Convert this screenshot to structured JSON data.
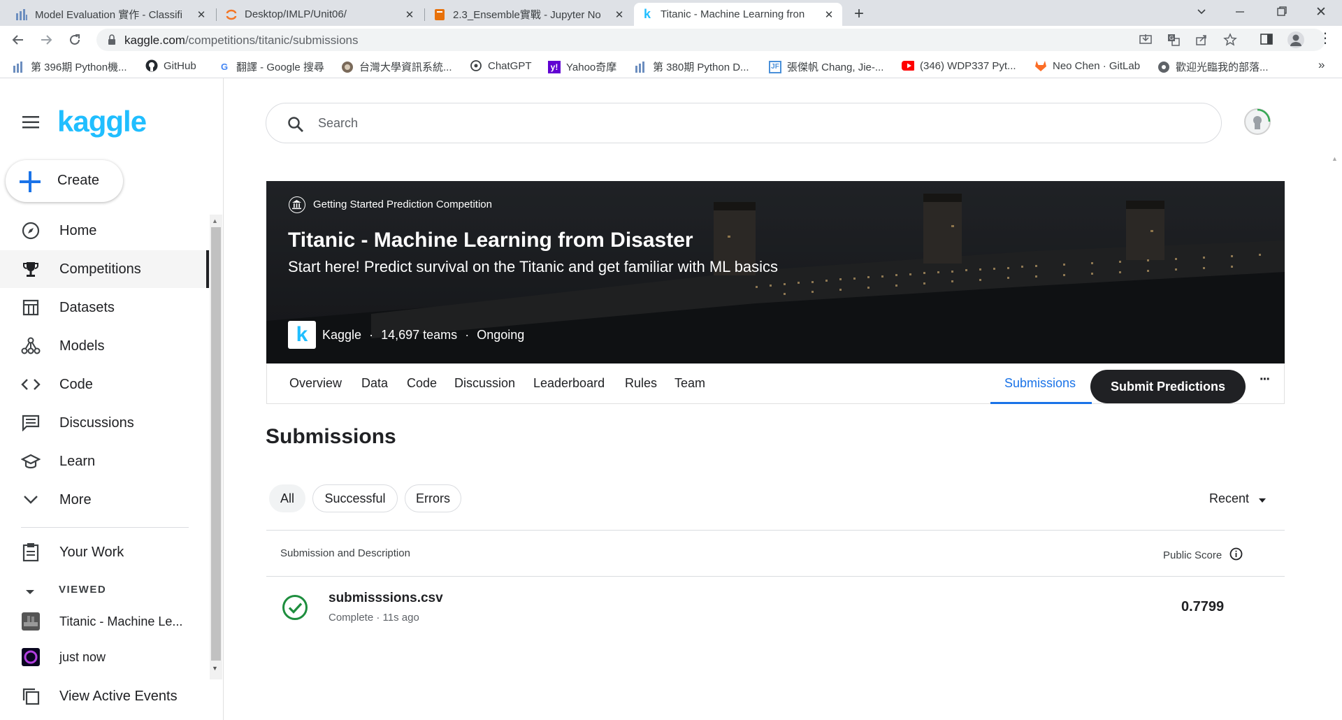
{
  "browser": {
    "tabs": [
      {
        "title": "Model Evaluation 實作 - Classifi",
        "icon": "bar-chart-icon",
        "color": "#1a73e8"
      },
      {
        "title": "Desktop/IMLP/Unit06/",
        "icon": "jupyter-icon",
        "color": "#f37626"
      },
      {
        "title": "2.3_Ensemble實戰 - Jupyter No",
        "icon": "notebook-icon",
        "color": "#e8710a"
      },
      {
        "title": "Titanic - Machine Learning fron",
        "icon": "kaggle-k-icon",
        "color": "#20beff",
        "active": true
      }
    ],
    "new_tab": "+",
    "url_host": "kaggle.com",
    "url_path": "/competitions/titanic/submissions",
    "bookmarks": [
      {
        "label": "第 396期 Python機...",
        "icon": "bar-chart-icon"
      },
      {
        "label": "GitHub",
        "icon": "github-icon"
      },
      {
        "label": "翻譯 - Google 搜尋",
        "icon": "google-g-icon"
      },
      {
        "label": "台灣大學資訊系統...",
        "icon": "seal-icon"
      },
      {
        "label": "ChatGPT",
        "icon": "chatgpt-icon"
      },
      {
        "label": "Yahoo奇摩",
        "icon": "yahoo-icon"
      },
      {
        "label": "第 380期 Python D...",
        "icon": "bar-chart-icon"
      },
      {
        "label": "張傑帆 Chang, Jie-...",
        "icon": "jf-icon"
      },
      {
        "label": "(346) WDP337 Pyt...",
        "icon": "youtube-icon"
      },
      {
        "label": "Neo Chen · GitLab",
        "icon": "gitlab-icon"
      },
      {
        "label": "歡迎光臨我的部落...",
        "icon": "globe-icon"
      }
    ],
    "bookmarks_more": "»"
  },
  "sidebar": {
    "logo": "kaggle",
    "create_label": "Create",
    "items": [
      {
        "label": "Home",
        "icon": "compass-icon"
      },
      {
        "label": "Competitions",
        "icon": "trophy-icon",
        "selected": true
      },
      {
        "label": "Datasets",
        "icon": "table-icon"
      },
      {
        "label": "Models",
        "icon": "models-icon"
      },
      {
        "label": "Code",
        "icon": "code-icon"
      },
      {
        "label": "Discussions",
        "icon": "discussion-icon"
      },
      {
        "label": "Learn",
        "icon": "school-icon"
      },
      {
        "label": "More",
        "icon": "chevron-down-icon"
      }
    ],
    "your_work": "Your Work",
    "viewed_label": "VIEWED",
    "viewed_items": [
      {
        "label": "Titanic - Machine Le..."
      },
      {
        "label": "just now"
      }
    ],
    "active_events": "View Active Events"
  },
  "search": {
    "placeholder": "Search"
  },
  "competition": {
    "category": "Getting Started Prediction Competition",
    "title": "Titanic - Machine Learning from Disaster",
    "subtitle": "Start here! Predict survival on the Titanic and get familiar with ML basics",
    "host": "Kaggle",
    "teams": "14,697 teams",
    "status": "Ongoing",
    "sep": "·"
  },
  "comp_tabs": [
    "Overview",
    "Data",
    "Code",
    "Discussion",
    "Leaderboard",
    "Rules",
    "Team"
  ],
  "submissions_tab": "Submissions",
  "submit_button": "Submit Predictions",
  "more_menu": "···",
  "page_heading": "Submissions",
  "filters": [
    "All",
    "Successful",
    "Errors"
  ],
  "sort": {
    "label": "Recent"
  },
  "table": {
    "col_left": "Submission and Description",
    "col_right": "Public Score",
    "rows": [
      {
        "filename": "submisssions.csv",
        "status": "Complete · 11s ago",
        "score": "0.7799"
      }
    ]
  },
  "colors": {
    "kaggle_blue": "#20beff",
    "success_green": "#1e8e3e",
    "tab_blue": "#1a73e8"
  }
}
